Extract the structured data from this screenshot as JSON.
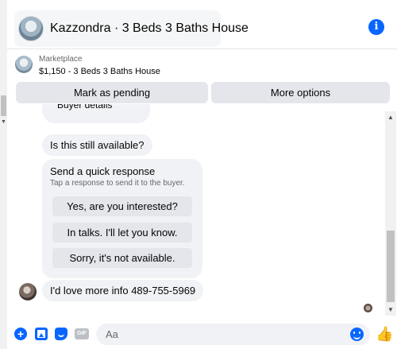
{
  "header": {
    "title": "Kazzondra · 3 Beds 3 Baths House",
    "info_icon": "info-icon",
    "info_glyph": "i"
  },
  "listing": {
    "source": "Marketplace",
    "title": "$1,150 - 3 Beds 3 Baths House"
  },
  "actions": {
    "mark_pending": "Mark as pending",
    "more_options": "More options"
  },
  "messages": {
    "partial_bubble": "Buyer details",
    "availability_question": "Is this still available?",
    "quick_response": {
      "title": "Send a quick response",
      "subtitle": "Tap a response to send it to the buyer.",
      "options": [
        "Yes, are you interested?",
        "In talks. I'll let you know.",
        "Sorry, it's not available."
      ]
    },
    "buyer_message": "I'd love more info 489-755-5969"
  },
  "composer": {
    "placeholder": "Aa",
    "gif_label": "GIF",
    "plus_glyph": "+",
    "like_glyph": "👍"
  },
  "colors": {
    "accent": "#0866ff",
    "bubble": "#f0f2f5",
    "button": "#e4e6eb",
    "secondary_text": "#65676b"
  }
}
